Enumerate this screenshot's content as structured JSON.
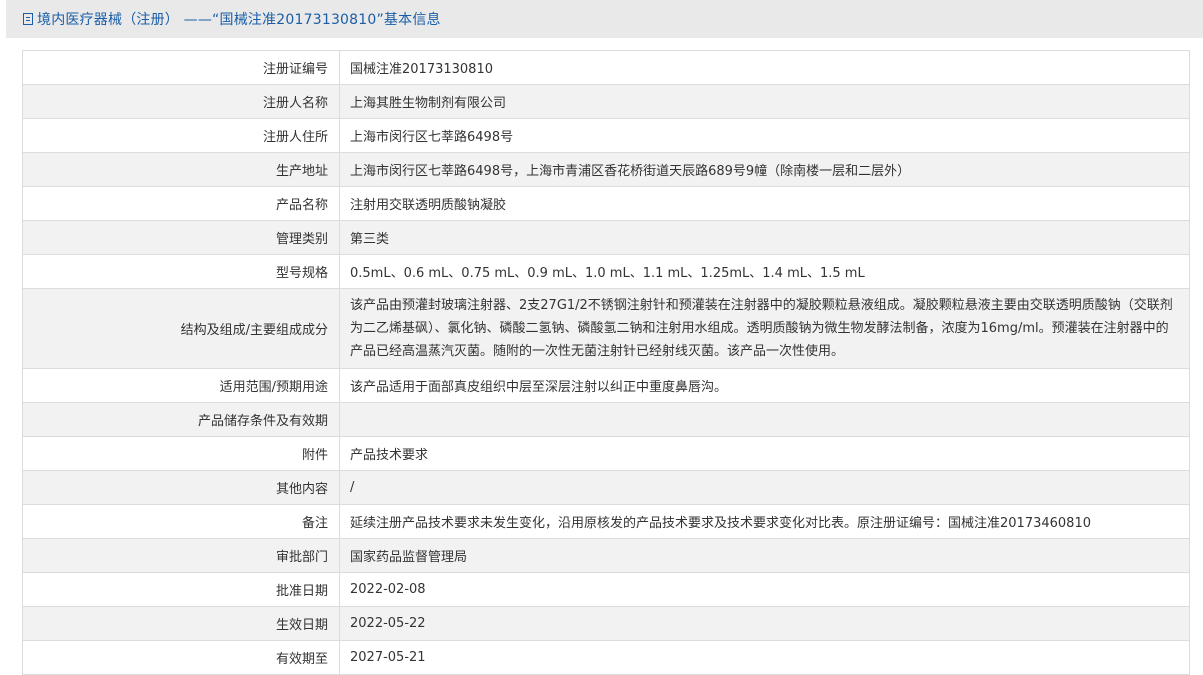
{
  "header": {
    "icon": "document-icon",
    "title": "境内医疗器械（注册） ——“国械注准20173130810”基本信息"
  },
  "rows": [
    {
      "label": "注册证编号",
      "value": "国械注准20173130810"
    },
    {
      "label": "注册人名称",
      "value": "上海其胜生物制剂有限公司"
    },
    {
      "label": "注册人住所",
      "value": "上海市闵行区七莘路6498号"
    },
    {
      "label": "生产地址",
      "value": "上海市闵行区七莘路6498号，上海市青浦区香花桥街道天辰路689号9幢（除南楼一层和二层外）"
    },
    {
      "label": "产品名称",
      "value": "注射用交联透明质酸钠凝胶"
    },
    {
      "label": "管理类别",
      "value": "第三类"
    },
    {
      "label": "型号规格",
      "value": "0.5mL、0.6 mL、0.75 mL、0.9 mL、1.0 mL、1.1 mL、1.25mL、1.4 mL、1.5 mL"
    },
    {
      "label": "结构及组成/主要组成成分",
      "value": "该产品由预灌封玻璃注射器、2支27G1/2不锈钢注射针和预灌装在注射器中的凝胶颗粒悬液组成。凝胶颗粒悬液主要由交联透明质酸钠（交联剂为二乙烯基砜）、氯化钠、磷酸二氢钠、磷酸氢二钠和注射用水组成。透明质酸钠为微生物发酵法制备，浓度为16mg/ml。预灌装在注射器中的产品已经高温蒸汽灭菌。随附的一次性无菌注射针已经射线灭菌。该产品一次性使用。"
    },
    {
      "label": "适用范围/预期用途",
      "value": "该产品适用于面部真皮组织中层至深层注射以纠正中重度鼻唇沟。"
    },
    {
      "label": "产品储存条件及有效期",
      "value": ""
    },
    {
      "label": "附件",
      "value": "产品技术要求"
    },
    {
      "label": "其他内容",
      "value": "/"
    },
    {
      "label": "备注",
      "value": "延续注册产品技术要求未发生变化，沿用原核发的产品技术要求及技术要求变化对比表。原注册证编号：国械注准20173460810"
    },
    {
      "label": "审批部门",
      "value": "国家药品监督管理局"
    },
    {
      "label": "批准日期",
      "value": "2022-02-08"
    },
    {
      "label": "生效日期",
      "value": "2022-05-22"
    },
    {
      "label": "有效期至",
      "value": "2027-05-21"
    }
  ]
}
